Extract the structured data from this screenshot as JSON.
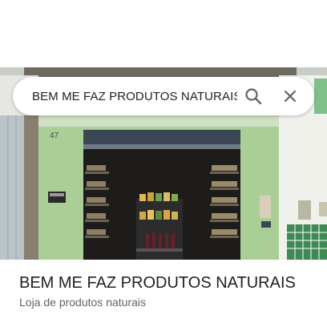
{
  "search": {
    "query": "BEM ME FAZ PRODUTOS NATURAIS"
  },
  "place": {
    "title": "BEM ME FAZ PRODUTOS NATURAIS",
    "category": "Loja de produtos naturais"
  },
  "storefront": {
    "address_number": "47"
  },
  "icons": {
    "search": "search-icon",
    "close": "close-icon"
  },
  "colors": {
    "wall_green": "#a9cf97",
    "tile_green": "#3e8a54",
    "text_primary": "#202124",
    "text_secondary": "#5f6368"
  }
}
